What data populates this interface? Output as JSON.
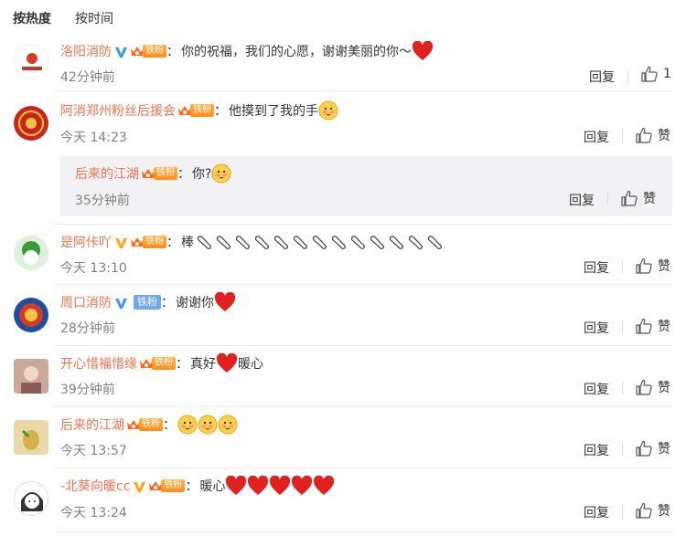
{
  "tabs": {
    "hot": "按热度",
    "time": "按时间"
  },
  "reply_label": "回复",
  "like_label": "赞",
  "colors": {
    "username": "#eb7350",
    "time": "#808080",
    "fan_badge": "#ff8c1a",
    "blue_badge": "#6fa8ee",
    "heart": "#e0211f"
  },
  "comments": [
    {
      "user": "洛阳消防",
      "fan": "铁粉",
      "text": "你的祝福，我们的心愿，谢谢美丽的你～",
      "time": "42分钟前",
      "likes": "1"
    },
    {
      "user": "阿消郑州粉丝后援会",
      "fan": "铁粉",
      "text": "他摸到了我的手",
      "time": "今天 14:23",
      "likes": "赞"
    },
    {
      "user": "后来的江湖",
      "fan": "铁粉",
      "text": "你?",
      "time": "35分钟前",
      "likes": "赞"
    },
    {
      "user": "是阿佧吖",
      "fan": "铁粉",
      "text": "棒",
      "time": "今天 13:10",
      "likes": "赞"
    },
    {
      "user": "周口消防",
      "fan": "铁粉",
      "text": "谢谢你",
      "time": "28分钟前",
      "likes": "赞"
    },
    {
      "user": "开心惜福惜缘",
      "fan": "铁粉",
      "text": "真好",
      "text2": "暖心",
      "time": "39分钟前",
      "likes": "赞"
    },
    {
      "user": "后来的江湖",
      "fan": "铁粉",
      "text": "",
      "time": "今天 13:57",
      "likes": "赞"
    },
    {
      "user": "-北葵向暖cc",
      "fan": "铁粉",
      "text": "暖心",
      "time": "今天 13:24",
      "likes": "赞"
    }
  ]
}
